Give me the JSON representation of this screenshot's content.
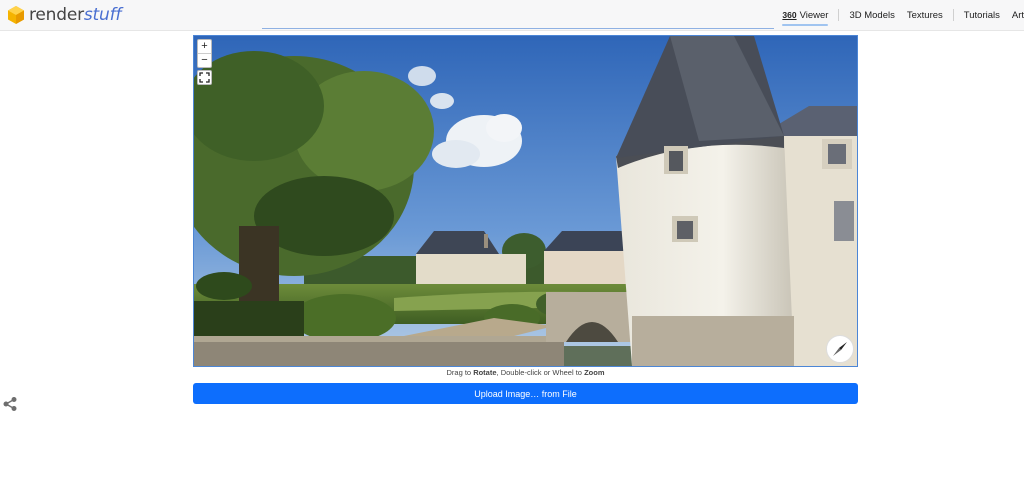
{
  "header": {
    "logo": {
      "part1": "render",
      "part2": "stuff"
    },
    "nav": [
      {
        "label": "360",
        "label2": "Viewer",
        "active": true
      },
      {
        "label": "3D Models"
      },
      {
        "label": "Textures"
      },
      {
        "label": "Tutorials"
      },
      {
        "label": "Art"
      }
    ]
  },
  "viewer": {
    "zoom_in": "+",
    "zoom_out": "−",
    "hint": {
      "pre": "Drag to ",
      "rotate": "Rotate",
      "mid": ", Double-click or Wheel to ",
      "zoom": "Zoom"
    }
  },
  "upload": {
    "label": "Upload Image… from File"
  },
  "colors": {
    "accent": "#0d6efd",
    "viewer_border": "#4c86d6"
  }
}
